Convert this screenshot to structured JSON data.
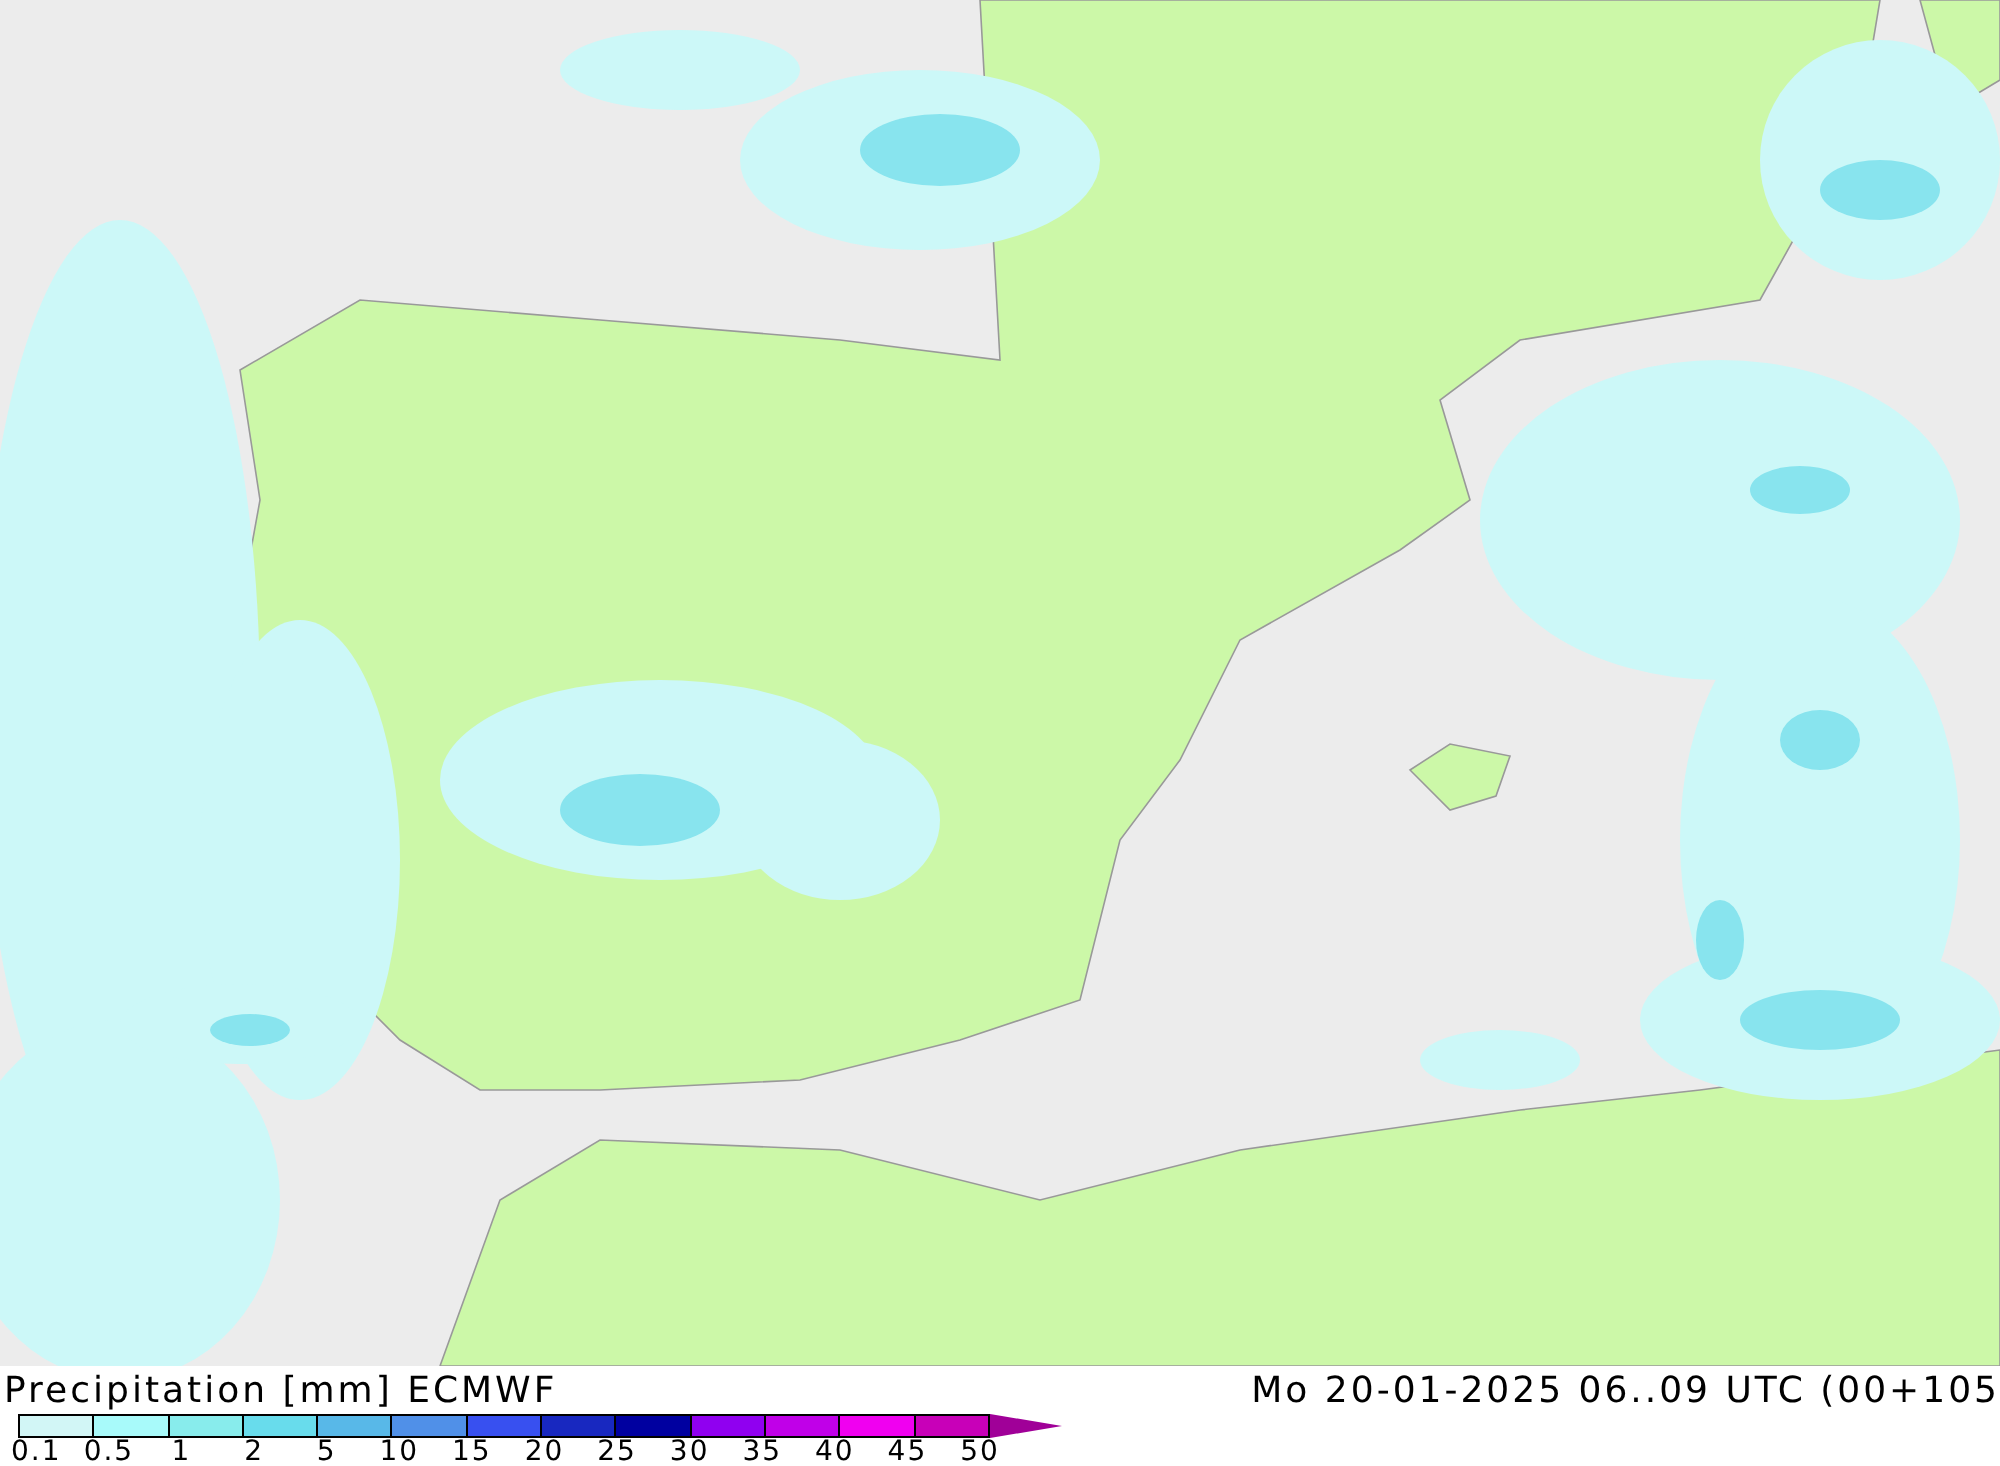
{
  "map": {
    "kind": "precipitation"
  },
  "legend": {
    "title": "Precipitation [mm] ECMWF",
    "valid_time": "Mo 20-01-2025 06..09 UTC (00+105",
    "swatches": [
      {
        "color": "#d2f6f6"
      },
      {
        "color": "#a8fafa"
      },
      {
        "color": "#88ecec"
      },
      {
        "color": "#68dcec"
      },
      {
        "color": "#58b8e8"
      },
      {
        "color": "#5090e8"
      },
      {
        "color": "#3850f0"
      },
      {
        "color": "#1828c0"
      },
      {
        "color": "#0000a0"
      },
      {
        "color": "#9000f0"
      },
      {
        "color": "#c000e8"
      },
      {
        "color": "#f000f0"
      },
      {
        "color": "#c800b8"
      }
    ],
    "labels": [
      "0.1",
      "0.5",
      "1",
      "2",
      "5",
      "10",
      "15",
      "20",
      "25",
      "30",
      "35",
      "40",
      "45",
      "50"
    ]
  }
}
